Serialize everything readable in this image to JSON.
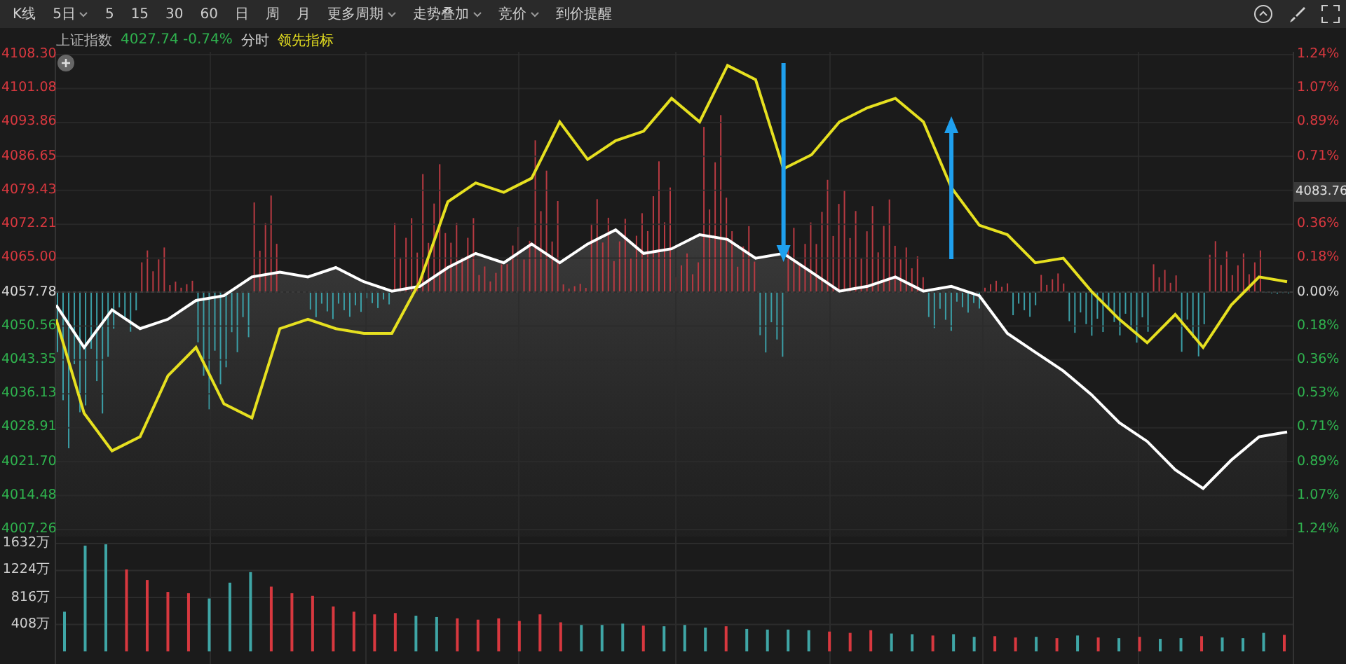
{
  "toolbar": {
    "items": [
      {
        "label": "K线",
        "dropdown": false,
        "selected": false
      },
      {
        "label": "5日",
        "dropdown": true,
        "selected": false
      },
      {
        "label": "5",
        "dropdown": false,
        "selected": false
      },
      {
        "label": "15",
        "dropdown": false,
        "selected": false
      },
      {
        "label": "30",
        "dropdown": false,
        "selected": false
      },
      {
        "label": "60",
        "dropdown": false,
        "selected": false
      },
      {
        "label": "日",
        "dropdown": false,
        "selected": false
      },
      {
        "label": "周",
        "dropdown": false,
        "selected": false
      },
      {
        "label": "月",
        "dropdown": false,
        "selected": false
      },
      {
        "label": "更多周期",
        "dropdown": true,
        "selected": false
      },
      {
        "label": "走势叠加",
        "dropdown": true,
        "selected": false
      },
      {
        "label": "竞价",
        "dropdown": true,
        "selected": false
      },
      {
        "label": "到价提醒",
        "dropdown": false,
        "selected": false
      }
    ]
  },
  "legend": {
    "quote": "4027.74 -0.74%",
    "mode": "分时"
  },
  "main_chart": {
    "crosshair_label": "4083.76",
    "right_axis": [
      {
        "label": "1.24%",
        "color": "#d8383f"
      },
      {
        "label": "1.07%",
        "color": "#d8383f"
      },
      {
        "label": "0.89%",
        "color": "#d8383f"
      },
      {
        "label": "0.71%",
        "color": "#d8383f"
      },
      {
        "label": "0.36%",
        "color": "#d8383f"
      },
      {
        "label": "0.18%",
        "color": "#d8383f"
      },
      {
        "label": "0.00%",
        "color": "#d8d8d8"
      },
      {
        "label": "0.18%",
        "color": "#2fb24e"
      },
      {
        "label": "0.36%",
        "color": "#2fb24e"
      },
      {
        "label": "0.53%",
        "color": "#2fb24e"
      },
      {
        "label": "0.71%",
        "color": "#2fb24e"
      },
      {
        "label": "0.89%",
        "color": "#2fb24e"
      },
      {
        "label": "1.07%",
        "color": "#2fb24e"
      },
      {
        "label": "1.24%",
        "color": "#2fb24e"
      }
    ],
    "chart_data": {
      "type": "line",
      "grid": true,
      "ylim": [
        4007.26,
        4108.3
      ],
      "yticks": [
        {
          "value": 4108.3,
          "label": "4108.30"
        },
        {
          "value": 4101.08,
          "label": "4101.08"
        },
        {
          "value": 4093.86,
          "label": "4093.86"
        },
        {
          "value": 4086.65,
          "label": "4086.65"
        },
        {
          "value": 4079.43,
          "label": "4079.43"
        },
        {
          "value": 4072.21,
          "label": "4072.21"
        },
        {
          "value": 4065.0,
          "label": "4065.00"
        },
        {
          "value": 4057.78,
          "label": "4057.78"
        },
        {
          "value": 4050.56,
          "label": "4050.56"
        },
        {
          "value": 4043.35,
          "label": "4043.35"
        },
        {
          "value": 4036.13,
          "label": "4036.13"
        },
        {
          "value": 4028.91,
          "label": "4028.91"
        },
        {
          "value": 4021.7,
          "label": "4021.70"
        },
        {
          "value": 4014.48,
          "label": "4014.48"
        },
        {
          "value": 4007.26,
          "label": "4007.26"
        }
      ],
      "series": [
        {
          "name": "上证指数",
          "color": "#ffffff",
          "values": [
            4055,
            4046,
            4054,
            4050,
            4052,
            4056,
            4057,
            4061,
            4062,
            4061,
            4063,
            4060,
            4058,
            4059,
            4063,
            4066,
            4064,
            4068,
            4064,
            4068,
            4071,
            4066,
            4067,
            4070,
            4069,
            4065,
            4066,
            4062,
            4058,
            4059,
            4061,
            4058,
            4059,
            4057,
            4049,
            4045,
            4041,
            4036,
            4030,
            4026,
            4020,
            4016,
            4022,
            4027,
            4028
          ]
        },
        {
          "name": "领先指标",
          "color": "#e6e020",
          "values": [
            4052,
            4032,
            4024,
            4027,
            4040,
            4046,
            4034,
            4031,
            4050,
            4052,
            4050,
            4049,
            4049,
            4060,
            4077,
            4081,
            4079,
            4082,
            4094,
            4086,
            4090,
            4092,
            4099,
            4094,
            4106,
            4103,
            4084,
            4087,
            4094,
            4097,
            4099,
            4094,
            4080,
            4072,
            4070,
            4064,
            4065,
            4058,
            4052,
            4047,
            4053,
            4046,
            4055,
            4061,
            4060
          ]
        }
      ]
    }
  },
  "volume_chart": {
    "chart_data": {
      "type": "bar",
      "grid": true,
      "stacked": true,
      "ylim": [
        0,
        1632
      ],
      "yticks": [
        {
          "value": 408,
          "label": "408万"
        },
        {
          "value": 816,
          "label": "816万"
        },
        {
          "value": 1224,
          "label": "1224万"
        },
        {
          "value": 1632,
          "label": "1632万"
        }
      ],
      "series": [
        {
          "color": "#d8383f",
          "values": [
            null,
            null,
            null,
            1240,
            1080,
            900,
            880,
            null,
            null,
            null,
            980,
            880,
            840,
            680,
            600,
            560,
            580,
            null,
            null,
            500,
            480,
            500,
            460,
            560,
            440,
            null,
            null,
            null,
            390,
            null,
            null,
            null,
            380,
            null,
            null,
            null,
            null,
            300,
            280,
            320,
            null,
            null,
            240,
            null,
            null,
            230,
            210,
            null,
            200,
            null,
            210,
            null,
            220,
            null,
            null,
            230,
            null,
            null,
            null,
            250
          ]
        },
        {
          "color": "#3fa6a6",
          "values": [
            600,
            1600,
            1620,
            null,
            null,
            null,
            null,
            800,
            1040,
            1200,
            null,
            null,
            null,
            null,
            null,
            null,
            null,
            540,
            520,
            null,
            null,
            null,
            null,
            null,
            null,
            400,
            400,
            420,
            null,
            380,
            400,
            360,
            null,
            340,
            330,
            330,
            320,
            null,
            null,
            null,
            270,
            260,
            null,
            260,
            220,
            null,
            null,
            220,
            null,
            240,
            null,
            200,
            null,
            190,
            200,
            null,
            210,
            200,
            280,
            null
          ]
        }
      ]
    }
  }
}
